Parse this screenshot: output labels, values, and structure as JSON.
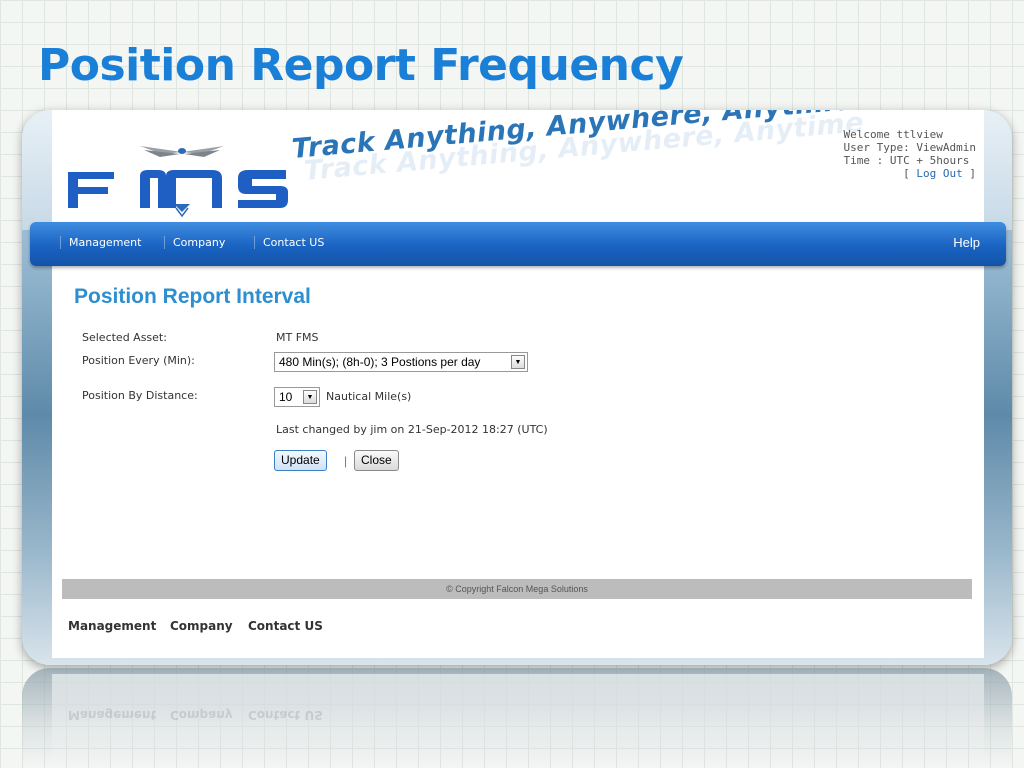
{
  "slide": {
    "title": "Position Report Frequency"
  },
  "app": {
    "logo_text": "FMS",
    "tagline": "Track Anything, Anywhere, Anytime",
    "user": {
      "welcome": "Welcome ttlview",
      "user_type": "User Type: ViewAdmin",
      "time": "Time : UTC + 5hours",
      "logout_open": "[",
      "logout_label": "Log Out",
      "logout_close": "]"
    },
    "nav": {
      "items": [
        "Management",
        "Company",
        "Contact US"
      ],
      "help": "Help"
    },
    "content": {
      "title": "Position Report Interval",
      "selected_asset_label": "Selected Asset:",
      "selected_asset_value": "MT FMS",
      "position_every_label": "Position Every (Min):",
      "position_every_value": "480 Min(s); (8h-0); 3 Postions per day",
      "position_by_distance_label": "Position By Distance:",
      "position_by_distance_value": "10",
      "distance_unit": "Nautical Mile(s)",
      "last_changed": "Last changed by jim on 21-Sep-2012 18:27 (UTC)",
      "update_button": "Update",
      "separator": "|",
      "close_button": "Close"
    },
    "footer": {
      "copyright": "© Copyright Falcon Mega Solutions",
      "links": [
        "Management",
        "Company",
        "Contact US"
      ]
    }
  },
  "colors": {
    "slide_title": "#1a7fd6",
    "logo_blue": "#1f5fc4",
    "navbar": "#1a63c2",
    "content_title": "#2d8fcf"
  }
}
